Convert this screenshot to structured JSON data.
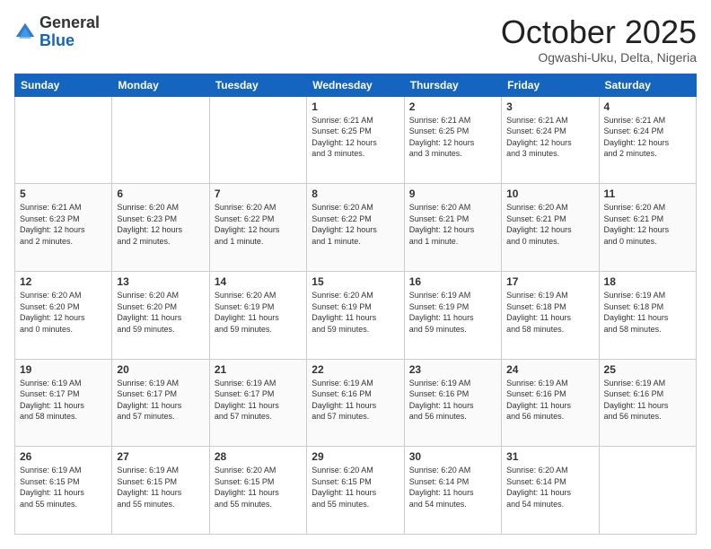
{
  "logo": {
    "general": "General",
    "blue": "Blue"
  },
  "header": {
    "month": "October 2025",
    "location": "Ogwashi-Uku, Delta, Nigeria"
  },
  "days": [
    "Sunday",
    "Monday",
    "Tuesday",
    "Wednesday",
    "Thursday",
    "Friday",
    "Saturday"
  ],
  "weeks": [
    [
      {
        "day": "",
        "info": ""
      },
      {
        "day": "",
        "info": ""
      },
      {
        "day": "",
        "info": ""
      },
      {
        "day": "1",
        "info": "Sunrise: 6:21 AM\nSunset: 6:25 PM\nDaylight: 12 hours\nand 3 minutes."
      },
      {
        "day": "2",
        "info": "Sunrise: 6:21 AM\nSunset: 6:25 PM\nDaylight: 12 hours\nand 3 minutes."
      },
      {
        "day": "3",
        "info": "Sunrise: 6:21 AM\nSunset: 6:24 PM\nDaylight: 12 hours\nand 3 minutes."
      },
      {
        "day": "4",
        "info": "Sunrise: 6:21 AM\nSunset: 6:24 PM\nDaylight: 12 hours\nand 2 minutes."
      }
    ],
    [
      {
        "day": "5",
        "info": "Sunrise: 6:21 AM\nSunset: 6:23 PM\nDaylight: 12 hours\nand 2 minutes."
      },
      {
        "day": "6",
        "info": "Sunrise: 6:20 AM\nSunset: 6:23 PM\nDaylight: 12 hours\nand 2 minutes."
      },
      {
        "day": "7",
        "info": "Sunrise: 6:20 AM\nSunset: 6:22 PM\nDaylight: 12 hours\nand 1 minute."
      },
      {
        "day": "8",
        "info": "Sunrise: 6:20 AM\nSunset: 6:22 PM\nDaylight: 12 hours\nand 1 minute."
      },
      {
        "day": "9",
        "info": "Sunrise: 6:20 AM\nSunset: 6:21 PM\nDaylight: 12 hours\nand 1 minute."
      },
      {
        "day": "10",
        "info": "Sunrise: 6:20 AM\nSunset: 6:21 PM\nDaylight: 12 hours\nand 0 minutes."
      },
      {
        "day": "11",
        "info": "Sunrise: 6:20 AM\nSunset: 6:21 PM\nDaylight: 12 hours\nand 0 minutes."
      }
    ],
    [
      {
        "day": "12",
        "info": "Sunrise: 6:20 AM\nSunset: 6:20 PM\nDaylight: 12 hours\nand 0 minutes."
      },
      {
        "day": "13",
        "info": "Sunrise: 6:20 AM\nSunset: 6:20 PM\nDaylight: 11 hours\nand 59 minutes."
      },
      {
        "day": "14",
        "info": "Sunrise: 6:20 AM\nSunset: 6:19 PM\nDaylight: 11 hours\nand 59 minutes."
      },
      {
        "day": "15",
        "info": "Sunrise: 6:20 AM\nSunset: 6:19 PM\nDaylight: 11 hours\nand 59 minutes."
      },
      {
        "day": "16",
        "info": "Sunrise: 6:19 AM\nSunset: 6:19 PM\nDaylight: 11 hours\nand 59 minutes."
      },
      {
        "day": "17",
        "info": "Sunrise: 6:19 AM\nSunset: 6:18 PM\nDaylight: 11 hours\nand 58 minutes."
      },
      {
        "day": "18",
        "info": "Sunrise: 6:19 AM\nSunset: 6:18 PM\nDaylight: 11 hours\nand 58 minutes."
      }
    ],
    [
      {
        "day": "19",
        "info": "Sunrise: 6:19 AM\nSunset: 6:17 PM\nDaylight: 11 hours\nand 58 minutes."
      },
      {
        "day": "20",
        "info": "Sunrise: 6:19 AM\nSunset: 6:17 PM\nDaylight: 11 hours\nand 57 minutes."
      },
      {
        "day": "21",
        "info": "Sunrise: 6:19 AM\nSunset: 6:17 PM\nDaylight: 11 hours\nand 57 minutes."
      },
      {
        "day": "22",
        "info": "Sunrise: 6:19 AM\nSunset: 6:16 PM\nDaylight: 11 hours\nand 57 minutes."
      },
      {
        "day": "23",
        "info": "Sunrise: 6:19 AM\nSunset: 6:16 PM\nDaylight: 11 hours\nand 56 minutes."
      },
      {
        "day": "24",
        "info": "Sunrise: 6:19 AM\nSunset: 6:16 PM\nDaylight: 11 hours\nand 56 minutes."
      },
      {
        "day": "25",
        "info": "Sunrise: 6:19 AM\nSunset: 6:16 PM\nDaylight: 11 hours\nand 56 minutes."
      }
    ],
    [
      {
        "day": "26",
        "info": "Sunrise: 6:19 AM\nSunset: 6:15 PM\nDaylight: 11 hours\nand 55 minutes."
      },
      {
        "day": "27",
        "info": "Sunrise: 6:19 AM\nSunset: 6:15 PM\nDaylight: 11 hours\nand 55 minutes."
      },
      {
        "day": "28",
        "info": "Sunrise: 6:20 AM\nSunset: 6:15 PM\nDaylight: 11 hours\nand 55 minutes."
      },
      {
        "day": "29",
        "info": "Sunrise: 6:20 AM\nSunset: 6:15 PM\nDaylight: 11 hours\nand 55 minutes."
      },
      {
        "day": "30",
        "info": "Sunrise: 6:20 AM\nSunset: 6:14 PM\nDaylight: 11 hours\nand 54 minutes."
      },
      {
        "day": "31",
        "info": "Sunrise: 6:20 AM\nSunset: 6:14 PM\nDaylight: 11 hours\nand 54 minutes."
      },
      {
        "day": "",
        "info": ""
      }
    ]
  ]
}
